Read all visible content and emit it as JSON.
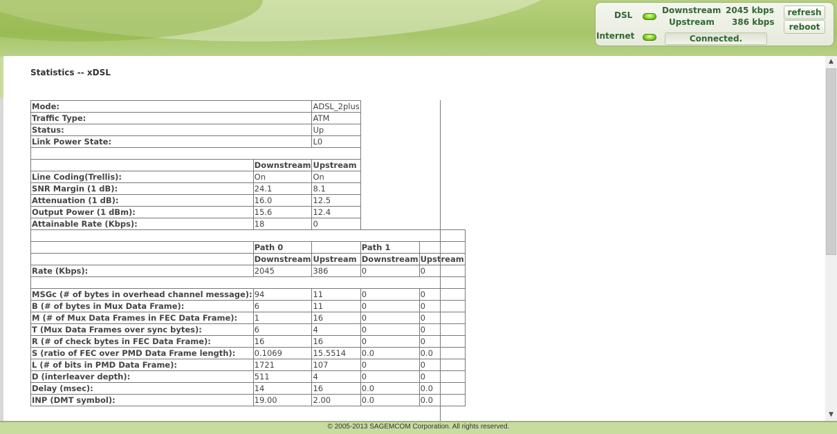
{
  "status_panel": {
    "dsl_label": "DSL",
    "internet_label": "Internet",
    "downstream_label": "Downstream",
    "downstream_value": "2045 kbps",
    "upstream_label": "Upstream",
    "upstream_value": "386 kbps",
    "connection_status": "Connected.",
    "refresh_label": "refresh",
    "reboot_label": "reboot"
  },
  "page": {
    "title": "Statistics -- xDSL"
  },
  "general": [
    {
      "label": "Mode:",
      "value": "ADSL_2plus"
    },
    {
      "label": "Traffic Type:",
      "value": "ATM"
    },
    {
      "label": "Status:",
      "value": "Up"
    },
    {
      "label": "Link Power State:",
      "value": "L0"
    }
  ],
  "line_headers": {
    "downstream": "Downstream",
    "upstream": "Upstream"
  },
  "line": [
    {
      "label": "Line Coding(Trellis):",
      "down": "On",
      "up": "On"
    },
    {
      "label": "SNR Margin (1 dB):",
      "down": "24.1",
      "up": "8.1"
    },
    {
      "label": "Attenuation (1 dB):",
      "down": "16.0",
      "up": "12.5"
    },
    {
      "label": "Output Power (1 dBm):",
      "down": "15.6",
      "up": "12.4"
    },
    {
      "label": "Attainable Rate (Kbps):",
      "down": "18",
      "up": "0"
    }
  ],
  "path_headers": {
    "path0": "Path 0",
    "path1": "Path 1",
    "downstream": "Downstream",
    "upstream": "Upstream"
  },
  "rate": {
    "label": "Rate (Kbps):",
    "p0_down": "2045",
    "p0_up": "386",
    "p1_down": "0",
    "p1_up": "0"
  },
  "path_rows": [
    {
      "label": "MSGc (# of bytes in overhead channel message):",
      "p0_down": "94",
      "p0_up": "11",
      "p1_down": "0",
      "p1_up": "0"
    },
    {
      "label": "B (# of bytes in Mux Data Frame):",
      "p0_down": "6",
      "p0_up": "11",
      "p1_down": "0",
      "p1_up": "0"
    },
    {
      "label": "M (# of Mux Data Frames in FEC Data Frame):",
      "p0_down": "1",
      "p0_up": "16",
      "p1_down": "0",
      "p1_up": "0"
    },
    {
      "label": "T (Mux Data Frames over sync bytes):",
      "p0_down": "6",
      "p0_up": "4",
      "p1_down": "0",
      "p1_up": "0"
    },
    {
      "label": "R (# of check bytes in FEC Data Frame):",
      "p0_down": "16",
      "p0_up": "16",
      "p1_down": "0",
      "p1_up": "0"
    },
    {
      "label": "S (ratio of FEC over PMD Data Frame length):",
      "p0_down": "0.1069",
      "p0_up": "15.5514",
      "p1_down": "0.0",
      "p1_up": "0.0"
    },
    {
      "label": "L (# of bits in PMD Data Frame):",
      "p0_down": "1721",
      "p0_up": "107",
      "p1_down": "0",
      "p1_up": "0"
    },
    {
      "label": "D (interleaver depth):",
      "p0_down": "511",
      "p0_up": "4",
      "p1_down": "0",
      "p1_up": "0"
    },
    {
      "label": "Delay (msec):",
      "p0_down": "14",
      "p0_up": "16",
      "p1_down": "0.0",
      "p1_up": "0.0"
    },
    {
      "label": "INP (DMT symbol):",
      "p0_down": "19.00",
      "p0_up": "2.00",
      "p1_down": "0.0",
      "p1_up": "0.0"
    }
  ],
  "footer": {
    "copyright": "© 2005-2013 SAGEMCOM Corporation. All rights reserved."
  }
}
